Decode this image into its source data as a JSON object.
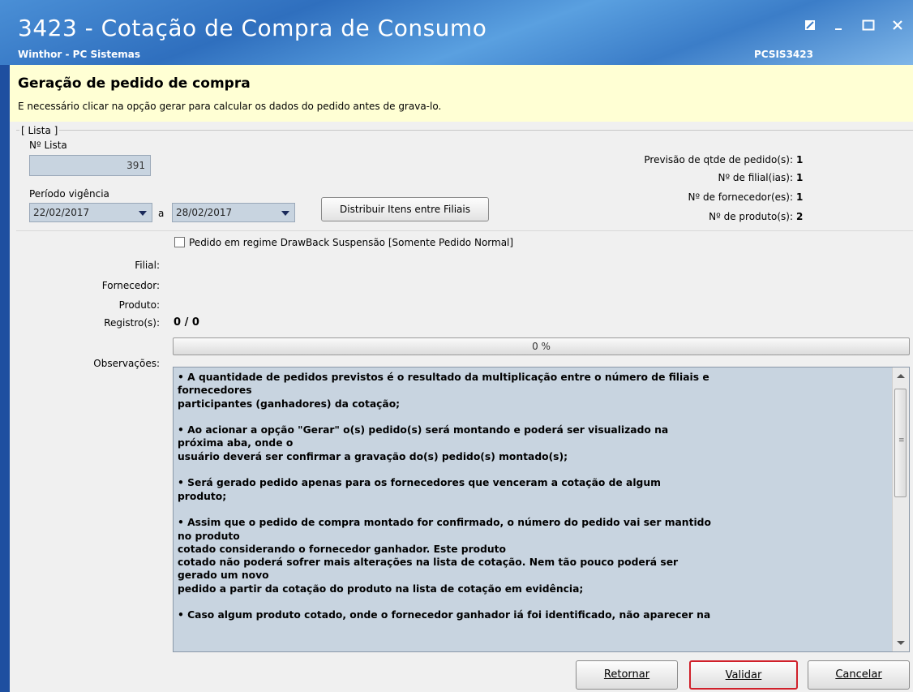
{
  "window": {
    "title": "3423 - Cotação de Compra de Consumo",
    "subtitle": "Winthor - PC Sistemas",
    "code": "PCSIS3423",
    "controls": [
      "restore-icon",
      "minimize-icon",
      "maximize-icon",
      "close-icon"
    ]
  },
  "banner": {
    "heading": "Geração de pedido de compra",
    "message": "E necessário clicar na opção gerar para calcular os dados do pedido antes de grava-lo."
  },
  "lista": {
    "group_label": "[ Lista ]",
    "num_label": "Nº Lista",
    "num_value": "391",
    "periodo_label": "Período vigência",
    "date_from": "22/02/2017",
    "date_sep": "a",
    "date_to": "28/02/2017",
    "distribuir_button": "Distribuir Itens entre Filiais"
  },
  "stats": [
    {
      "label": "Previsão de qtde de pedido(s):",
      "value": "1"
    },
    {
      "label": "Nº de filial(ias):",
      "value": "1"
    },
    {
      "label": "Nº de fornecedor(es):",
      "value": "1"
    },
    {
      "label": "Nº de produto(s):",
      "value": "2"
    }
  ],
  "drawback_label": "Pedido em regime DrawBack Suspensão [Somente Pedido Normal]",
  "fields": {
    "filial_label": "Filial:",
    "fornecedor_label": "Fornecedor:",
    "produto_label": "Produto:",
    "registros_label": "Registro(s):",
    "registros_value": "0 / 0",
    "observacoes_label": "Observações:"
  },
  "progress": {
    "text": "0 %",
    "value": 0
  },
  "observacoes": "• A quantidade de pedidos previstos é o resultado da multiplicação entre o número de filiais e\nfornecedores\nparticipantes (ganhadores) da cotação;\n\n• Ao acionar a opção \"Gerar\" o(s) pedido(s) será montando e poderá ser visualizado na\npróxima aba, onde o\nusuário deverá ser confirmar a gravação do(s) pedido(s) montado(s);\n\n• Será gerado pedido apenas para os fornecedores que venceram a cotação de algum\nproduto;\n\n• Assim que o pedido de compra montado for confirmado, o número do pedido vai ser mantido\nno produto\ncotado considerando o fornecedor ganhador. Este produto\ncotado não poderá sofrer mais alterações na lista de cotação. Nem tão pouco poderá ser\ngerado um novo\npedido a partir da cotação do produto na lista de cotação em evidência;\n\n• Caso algum produto cotado, onde o fornecedor ganhador iá foi identificado, não aparecer na",
  "buttons": {
    "retornar": "Retornar",
    "validar": "Validar",
    "cancelar": "Cancelar"
  }
}
